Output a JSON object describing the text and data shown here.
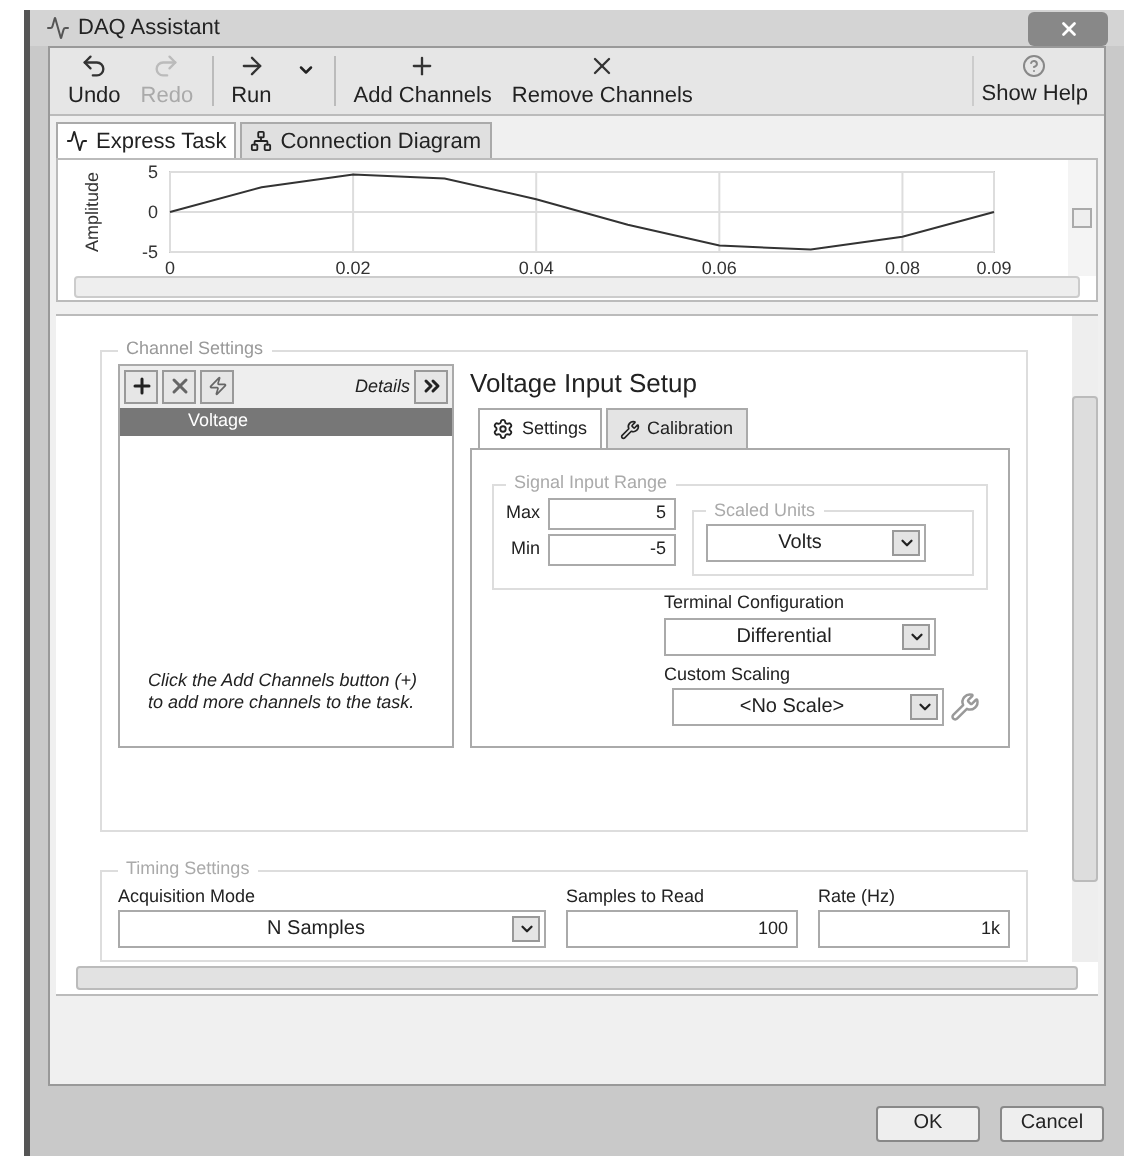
{
  "window": {
    "title": "DAQ Assistant"
  },
  "toolbar": [
    {
      "label": "Undo",
      "disabled": false,
      "dropdown": false
    },
    {
      "label": "Redo",
      "disabled": true,
      "dropdown": false
    },
    {
      "label": "Run",
      "disabled": false,
      "dropdown": true
    },
    {
      "label": "Add Channels",
      "disabled": false,
      "dropdown": false
    },
    {
      "label": "Remove Channels",
      "disabled": false,
      "dropdown": false
    }
  ],
  "help_button": {
    "label": "Show Help"
  },
  "tabs": [
    {
      "label": "Express Task",
      "selected": true
    },
    {
      "label": "Connection Diagram",
      "selected": false
    }
  ],
  "chart": {
    "chart_data": {
      "type": "line",
      "ylabel": "Amplitude",
      "grid": true,
      "x": [
        0,
        0.01,
        0.02,
        0.03,
        0.04,
        0.05,
        0.06,
        0.07,
        0.08,
        0.09
      ],
      "series": [
        {
          "color": "#333333",
          "values": [
            0,
            3.1,
            4.7,
            4.2,
            1.6,
            -1.6,
            -4.2,
            -4.7,
            -3.1,
            0
          ]
        }
      ],
      "xlim": [
        0,
        0.09
      ],
      "ylim": [
        -5,
        5
      ],
      "xticks": [
        0,
        0.02,
        0.04,
        0.06,
        0.08,
        0.09
      ],
      "yticks": [
        -5,
        0,
        5
      ]
    }
  },
  "channel_settings": {
    "title": "Channel Settings",
    "details_label": "Details",
    "channels": [
      {
        "name": "Voltage",
        "selected": true
      }
    ],
    "hint": "Click the Add Channels button (+) to add more channels to the task."
  },
  "voltage_setup": {
    "title": "Voltage Input Setup",
    "tabs": [
      {
        "label": "Settings",
        "selected": true
      },
      {
        "label": "Calibration",
        "selected": false
      }
    ],
    "signal_input_range": {
      "title": "Signal Input Range",
      "max_label": "Max",
      "max_value": "5",
      "min_label": "Min",
      "min_value": "-5"
    },
    "scaled_units": {
      "title": "Scaled Units",
      "value": "Volts"
    },
    "terminal_configuration": {
      "label": "Terminal Configuration",
      "value": "Differential"
    },
    "custom_scaling": {
      "label": "Custom Scaling",
      "value": "<No Scale>"
    }
  },
  "timing_settings": {
    "title": "Timing Settings",
    "acquisition_mode": {
      "label": "Acquisition Mode",
      "value": "N Samples"
    },
    "samples_to_read": {
      "label": "Samples to Read",
      "value": "100"
    },
    "rate": {
      "label": "Rate (Hz)",
      "value": "1k"
    }
  },
  "buttons": [
    "OK",
    "Cancel"
  ]
}
